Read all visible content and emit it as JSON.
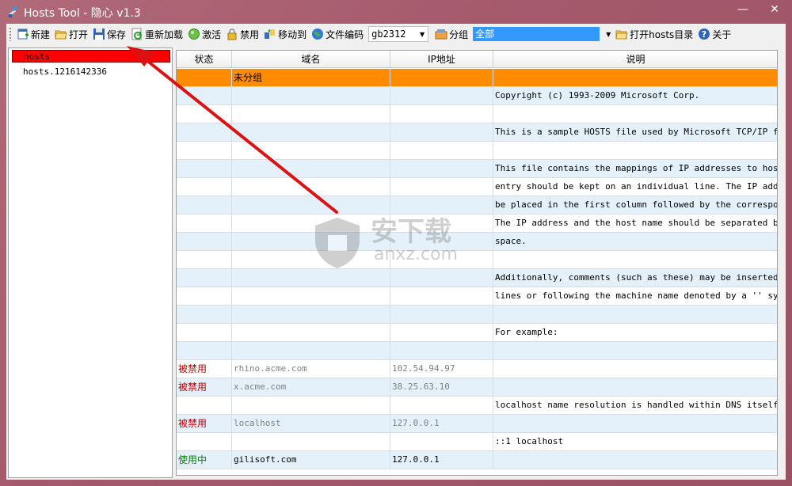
{
  "window": {
    "title": "Hosts Tool - 隐心 v1.3",
    "minimize_glyph": "—",
    "close_glyph": "✕"
  },
  "toolbar": {
    "new_label": "新建",
    "open_label": "打开",
    "save_label": "保存",
    "reload_label": "重新加载",
    "activate_label": "激活",
    "disable_label": "禁用",
    "move_label": "移动到",
    "encoding_label": "文件编码",
    "encoding_value": "gb2312",
    "group_label": "分组",
    "group_value": "全部",
    "open_dir_label": "打开hosts目录",
    "about_label": "关于"
  },
  "tree": {
    "items": [
      {
        "label": "hosts"
      },
      {
        "label": "hosts.1216142336"
      }
    ]
  },
  "grid": {
    "headers": [
      "状态",
      "域名",
      "IP地址",
      "说明"
    ],
    "rows": [
      {
        "status": "",
        "domain": "未分组",
        "ip": "",
        "note": "",
        "kind": "group"
      },
      {
        "status": "",
        "domain": "",
        "ip": "",
        "note": "Copyright (c) 1993-2009 Microsoft Corp.",
        "kind": "blue"
      },
      {
        "status": "",
        "domain": "",
        "ip": "",
        "note": "",
        "kind": "white"
      },
      {
        "status": "",
        "domain": "",
        "ip": "",
        "note": "This is a sample HOSTS file used by Microsoft TCP/IP for...",
        "kind": "blue"
      },
      {
        "status": "",
        "domain": "",
        "ip": "",
        "note": "",
        "kind": "white"
      },
      {
        "status": "",
        "domain": "",
        "ip": "",
        "note": "This file contains the mappings of IP addresses to host ...",
        "kind": "blue"
      },
      {
        "status": "",
        "domain": "",
        "ip": "",
        "note": "entry should be kept on an individual line. The IP addre...",
        "kind": "white"
      },
      {
        "status": "",
        "domain": "",
        "ip": "",
        "note": "be placed in the first column followed by the correspond...",
        "kind": "blue"
      },
      {
        "status": "",
        "domain": "",
        "ip": "",
        "note": "The IP address and the host name should be separated by ...",
        "kind": "white"
      },
      {
        "status": "",
        "domain": "",
        "ip": "",
        "note": "space.",
        "kind": "blue"
      },
      {
        "status": "",
        "domain": "",
        "ip": "",
        "note": "",
        "kind": "white"
      },
      {
        "status": "",
        "domain": "",
        "ip": "",
        "note": "Additionally, comments (such as these) may be inserted o...",
        "kind": "blue"
      },
      {
        "status": "",
        "domain": "",
        "ip": "",
        "note": "lines or following the machine name denoted by a '' symbol.",
        "kind": "white"
      },
      {
        "status": "",
        "domain": "",
        "ip": "",
        "note": "",
        "kind": "blue"
      },
      {
        "status": "",
        "domain": "",
        "ip": "",
        "note": "For example:",
        "kind": "white"
      },
      {
        "status": "",
        "domain": "",
        "ip": "",
        "note": "",
        "kind": "blue"
      },
      {
        "status": "被禁用",
        "domain": "rhino.acme.com",
        "ip": "102.54.94.97",
        "note": "",
        "kind": "white",
        "state": "disabled"
      },
      {
        "status": "被禁用",
        "domain": "x.acme.com",
        "ip": "38.25.63.10",
        "note": "",
        "kind": "blue",
        "state": "disabled"
      },
      {
        "status": "",
        "domain": "",
        "ip": "",
        "note": "localhost name resolution is handled within DNS itself.",
        "kind": "white"
      },
      {
        "status": "被禁用",
        "domain": "localhost",
        "ip": "127.0.0.1",
        "note": "",
        "kind": "blue",
        "state": "disabled"
      },
      {
        "status": "",
        "domain": "",
        "ip": "",
        "note": "::1 localhost",
        "kind": "white"
      },
      {
        "status": "使用中",
        "domain": "gilisoft.com",
        "ip": "127.0.0.1",
        "note": "",
        "kind": "blue",
        "state": "active"
      }
    ]
  },
  "watermark": {
    "line1": "安下载",
    "line2": "anxz.com"
  },
  "colors": {
    "group_row": "#ff8c00",
    "alt_row": "#e4f1fb",
    "selected_tree": "#ff0000",
    "disabled_text": "#c00000",
    "active_text": "#008000",
    "annotation_arrow": "#dd1111"
  }
}
